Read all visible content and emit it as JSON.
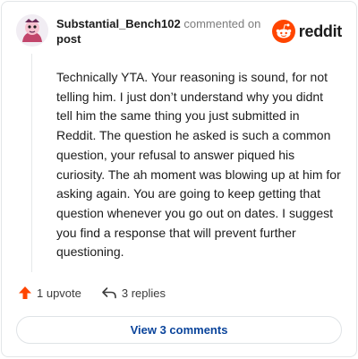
{
  "comment": {
    "username": "Substantial_Bench102",
    "action_text": "commented on",
    "post_link": "post",
    "body": "Technically YTA. Your reasoning is sound, for not telling him. I just don’t understand why you didnt tell him the same thing you just submitted in Reddit. The question he asked is such a common question, your refusal to answer piqued his curiosity. The ah moment was blowing up at him for asking again. You are going to keep getting that question whenever you go out on dates. I suggest you find a response that will prevent further questioning."
  },
  "brand": {
    "wordmark": "reddit",
    "color": "#ff4500",
    "icon": "reddit-snoo-icon"
  },
  "actions": {
    "upvote_label": "1 upvote",
    "upvote_icon": "upvote-arrow-icon",
    "replies_label": "3 replies",
    "replies_icon": "reply-arrow-icon"
  },
  "view_button": {
    "label": "View 3 comments",
    "color": "#0a449b"
  }
}
